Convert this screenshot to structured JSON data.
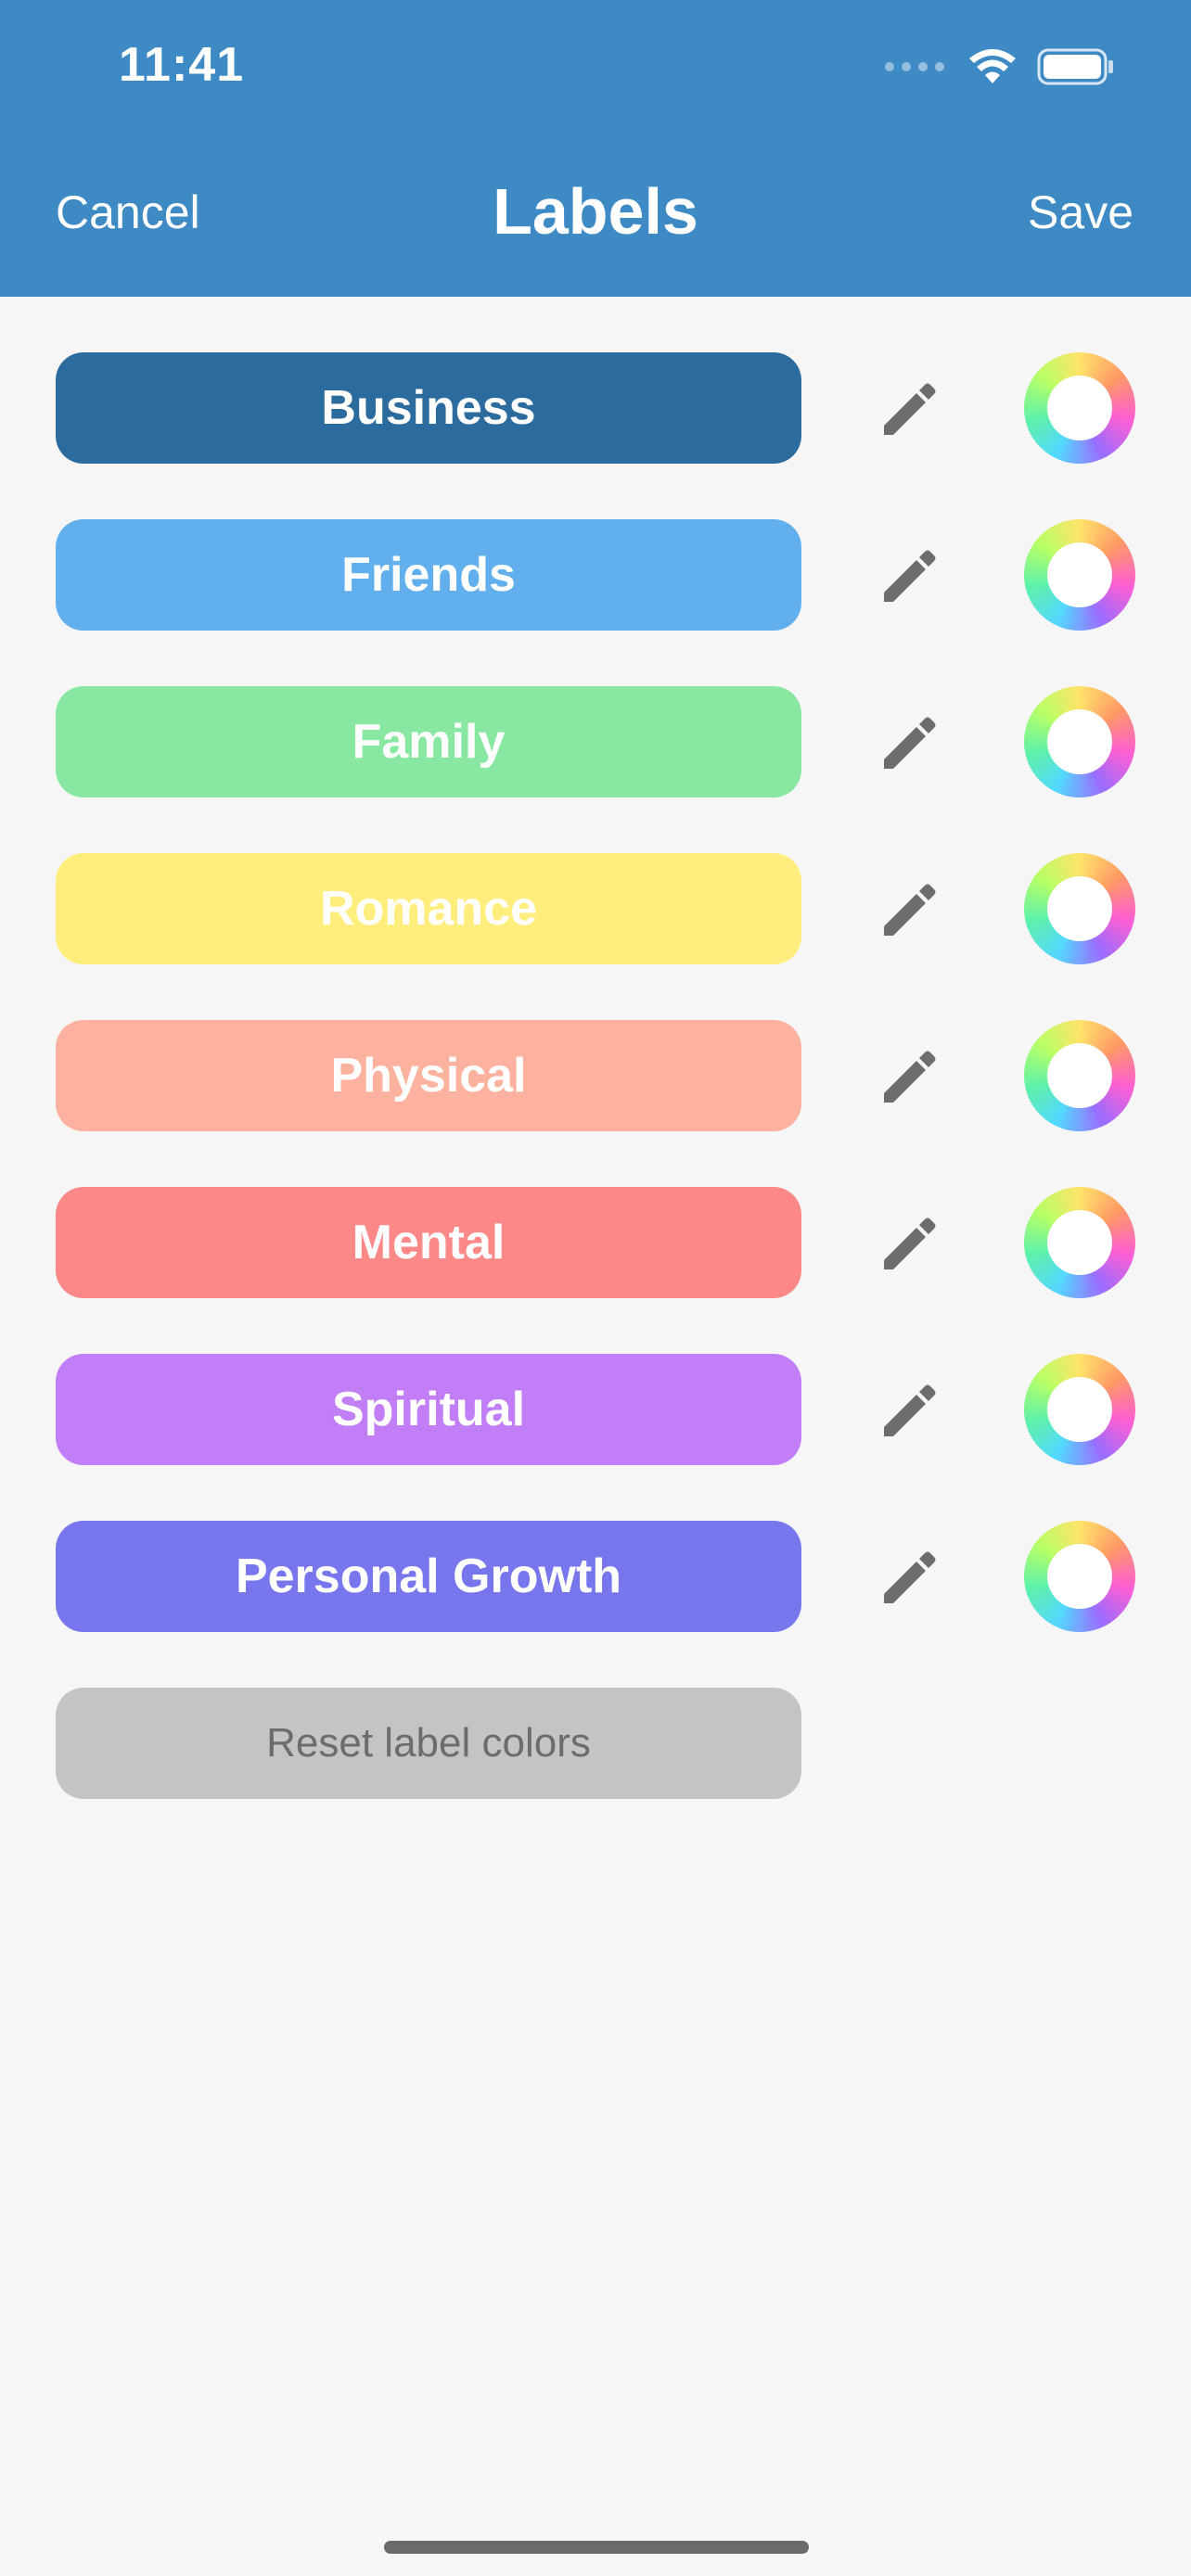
{
  "status_bar": {
    "time": "11:41",
    "icons": [
      "signal-icon",
      "wifi-icon",
      "battery-icon"
    ]
  },
  "nav": {
    "cancel_label": "Cancel",
    "title": "Labels",
    "save_label": "Save"
  },
  "labels": [
    {
      "name": "Business",
      "color": "#2c6b9e"
    },
    {
      "name": "Friends",
      "color": "#62afee"
    },
    {
      "name": "Family",
      "color": "#88e8a2"
    },
    {
      "name": "Romance",
      "color": "#ffee7e"
    },
    {
      "name": "Physical",
      "color": "#fcb29e"
    },
    {
      "name": "Mental",
      "color": "#fd8888"
    },
    {
      "name": "Spiritual",
      "color": "#c17ef6"
    },
    {
      "name": "Personal Growth",
      "color": "#7876ed"
    }
  ],
  "row_icons": {
    "edit": "pencil-icon",
    "color": "color-wheel-icon"
  },
  "reset_button_label": "Reset label colors",
  "colors": {
    "header": "#3d8ac5",
    "background": "#f6f6f6",
    "reset_button": "#c4c4c4",
    "icon": "#6d6d6d"
  }
}
